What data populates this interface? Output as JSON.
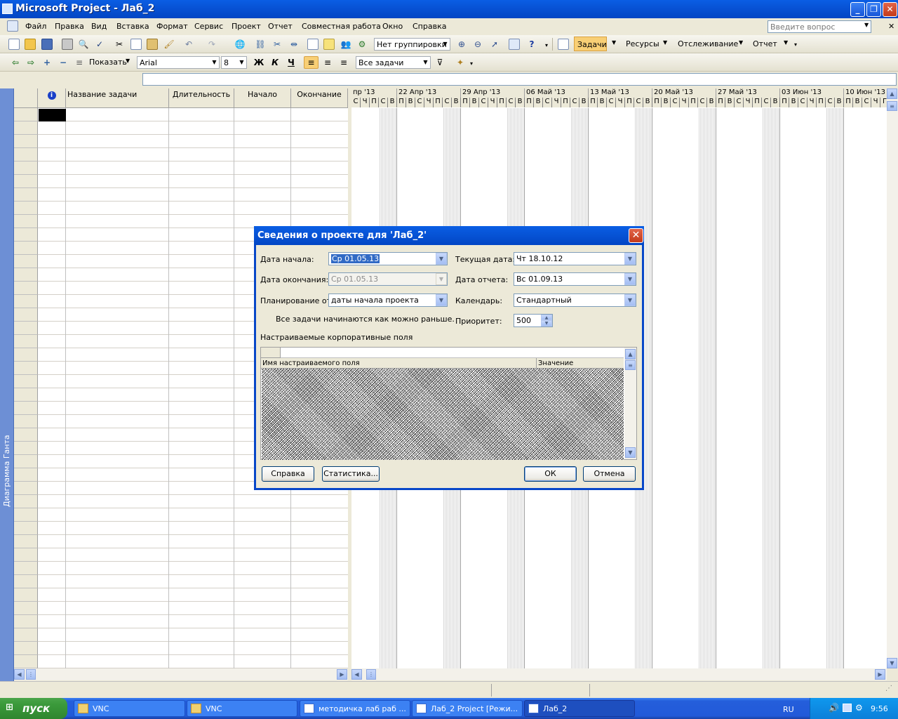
{
  "window": {
    "title": "Microsoft Project - Лаб_2"
  },
  "menu": {
    "items": [
      "Файл",
      "Правка",
      "Вид",
      "Вставка",
      "Формат",
      "Сервис",
      "Проект",
      "Отчет",
      "Совместная работа",
      "Окно",
      "Справка"
    ],
    "help_placeholder": "Введите вопрос"
  },
  "toolbar1": {
    "grouping": "Нет группировки",
    "tasks_btn": "Задачи",
    "resources_btn": "Ресурсы",
    "tracking_btn": "Отслеживание",
    "report_btn": "Отчет"
  },
  "toolbar2": {
    "show_btn": "Показать",
    "font": "Arial",
    "font_size": "8",
    "bold": "Ж",
    "italic": "К",
    "underline": "Ч",
    "filter": "Все задачи"
  },
  "view_bar": {
    "label": "Диаграмма Ганта"
  },
  "table": {
    "columns": [
      "Название задачи",
      "Длительность",
      "Начало",
      "Окончание"
    ],
    "info_icon": "i"
  },
  "gantt": {
    "weeks": [
      "пр '13",
      "22 Апр '13",
      "29 Апр '13",
      "06 Май '13",
      "13 Май '13",
      "20 Май '13",
      "27 Май '13",
      "03 Июн '13",
      "10 Июн '13"
    ],
    "days_first": [
      "С",
      "Ч",
      "П",
      "С",
      "В"
    ],
    "days": [
      "П",
      "В",
      "С",
      "Ч",
      "П",
      "С",
      "В"
    ],
    "days_last": [
      "П",
      "В",
      "С",
      "Ч",
      "Г"
    ]
  },
  "dialog": {
    "title": "Сведения о проекте для 'Лаб_2'",
    "start_date_label": "Дата начала:",
    "start_date": "Ср 01.05.13",
    "finish_date_label": "Дата окончания:",
    "finish_date": "Ср 01.05.13",
    "schedule_from_label": "Планирование от:",
    "schedule_from": "даты начала проекта",
    "note": "Все задачи начинаются как можно раньше.",
    "current_date_label": "Текущая дата:",
    "current_date": "Чт 18.10.12",
    "status_date_label": "Дата отчета:",
    "status_date": "Вс 01.09.13",
    "calendar_label": "Календарь:",
    "calendar": "Стандартный",
    "priority_label": "Приоритет:",
    "priority": "500",
    "custom_fields_label": "Настраиваемые корпоративные поля",
    "col_field_name": "Имя настраиваемого поля",
    "col_value": "Значение",
    "help_btn": "Справка",
    "stats_btn": "Статистика...",
    "ok_btn": "ОК",
    "cancel_btn": "Отмена"
  },
  "taskbar": {
    "start": "пуск",
    "tasks": [
      "VNC",
      "VNC",
      "методичка лаб раб ...",
      "Лаб_2 Project [Режи...",
      "Лаб_2"
    ],
    "lang": "RU",
    "clock": "9:56"
  }
}
